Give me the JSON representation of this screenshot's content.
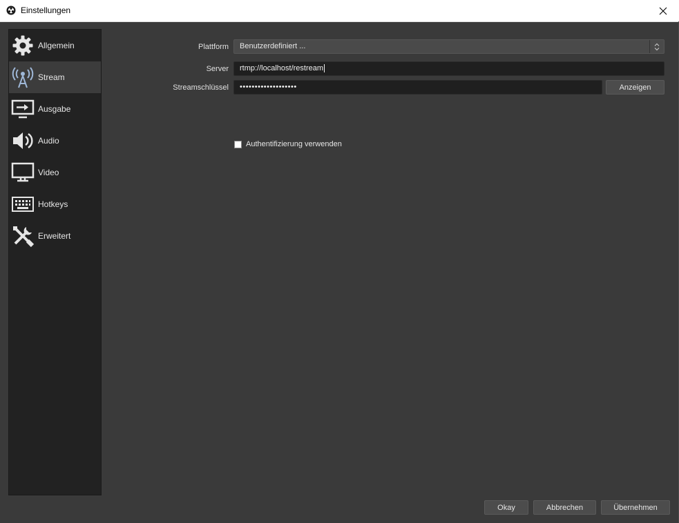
{
  "window": {
    "title": "Einstellungen"
  },
  "sidebar": {
    "items": [
      {
        "label": "Allgemein",
        "icon": "gear-icon",
        "active": false
      },
      {
        "label": "Stream",
        "icon": "broadcast-tower-icon",
        "active": true
      },
      {
        "label": "Ausgabe",
        "icon": "output-icon",
        "active": false
      },
      {
        "label": "Audio",
        "icon": "speaker-icon",
        "active": false
      },
      {
        "label": "Video",
        "icon": "monitor-icon",
        "active": false
      },
      {
        "label": "Hotkeys",
        "icon": "keyboard-icon",
        "active": false
      },
      {
        "label": "Erweitert",
        "icon": "tools-icon",
        "active": false
      }
    ]
  },
  "stream": {
    "platform_label": "Plattform",
    "platform_value": "Benutzerdefiniert ...",
    "server_label": "Server",
    "server_value": "rtmp://localhost/restream",
    "key_label": "Streamschlüssel",
    "key_value": "•••••••••••••••••••",
    "show_button": "Anzeigen",
    "auth_label": "Authentifizierung verwenden",
    "auth_checked": false
  },
  "footer": {
    "ok": "Okay",
    "cancel": "Abbrechen",
    "apply": "Übernehmen"
  },
  "colors": {
    "background": "#3a3a3a",
    "sidebar": "#222222",
    "active_item": "#3c3c3c",
    "input": "#1f1f1f"
  }
}
